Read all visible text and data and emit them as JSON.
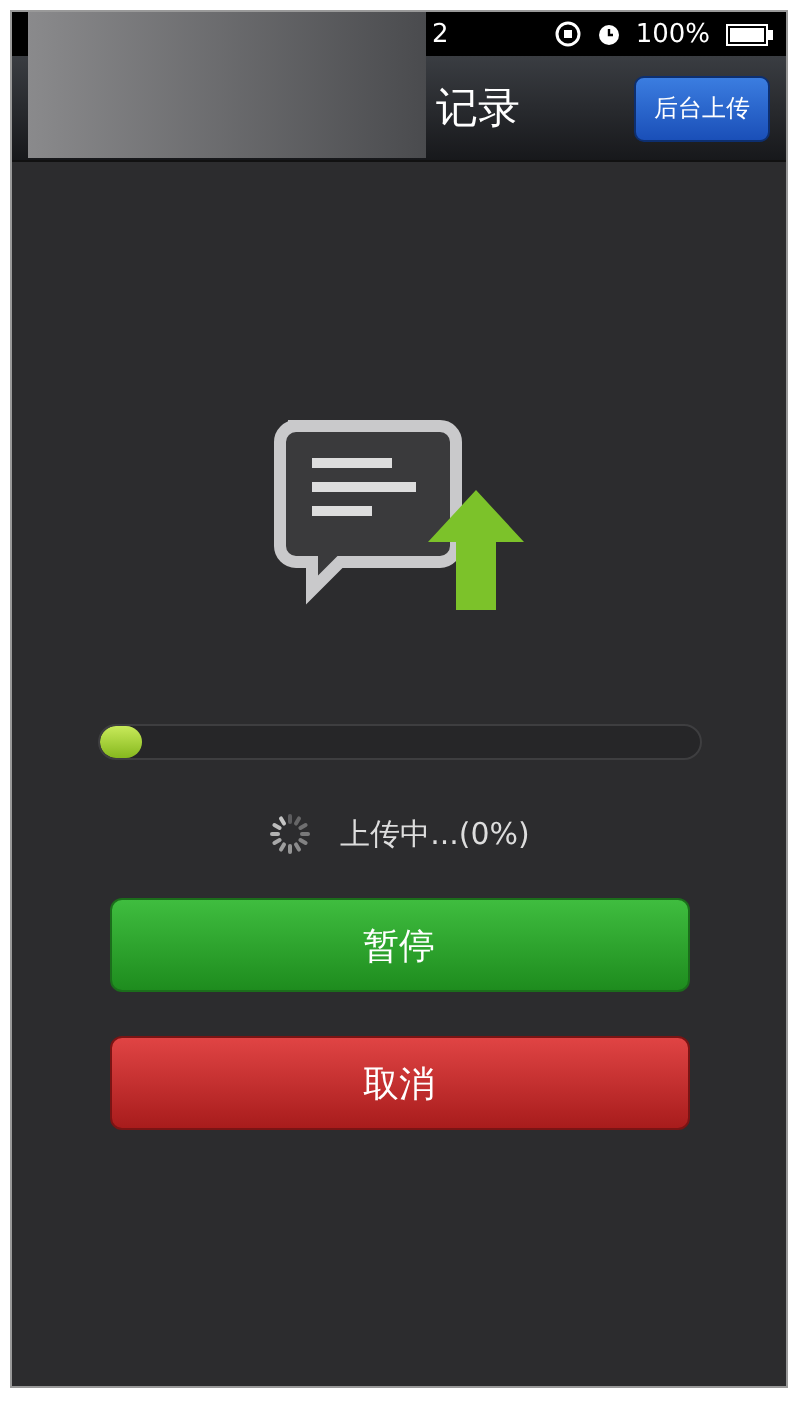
{
  "status_bar": {
    "time": "2",
    "battery": "100%"
  },
  "nav_bar": {
    "title": "记录",
    "action_button": "后台上传"
  },
  "upload": {
    "level": 0.07,
    "status": "上传中...(0%)"
  },
  "buttons": [
    {
      "label": "暂停",
      "kind": "pause"
    },
    {
      "label": "取消",
      "kind": "cancel"
    }
  ]
}
